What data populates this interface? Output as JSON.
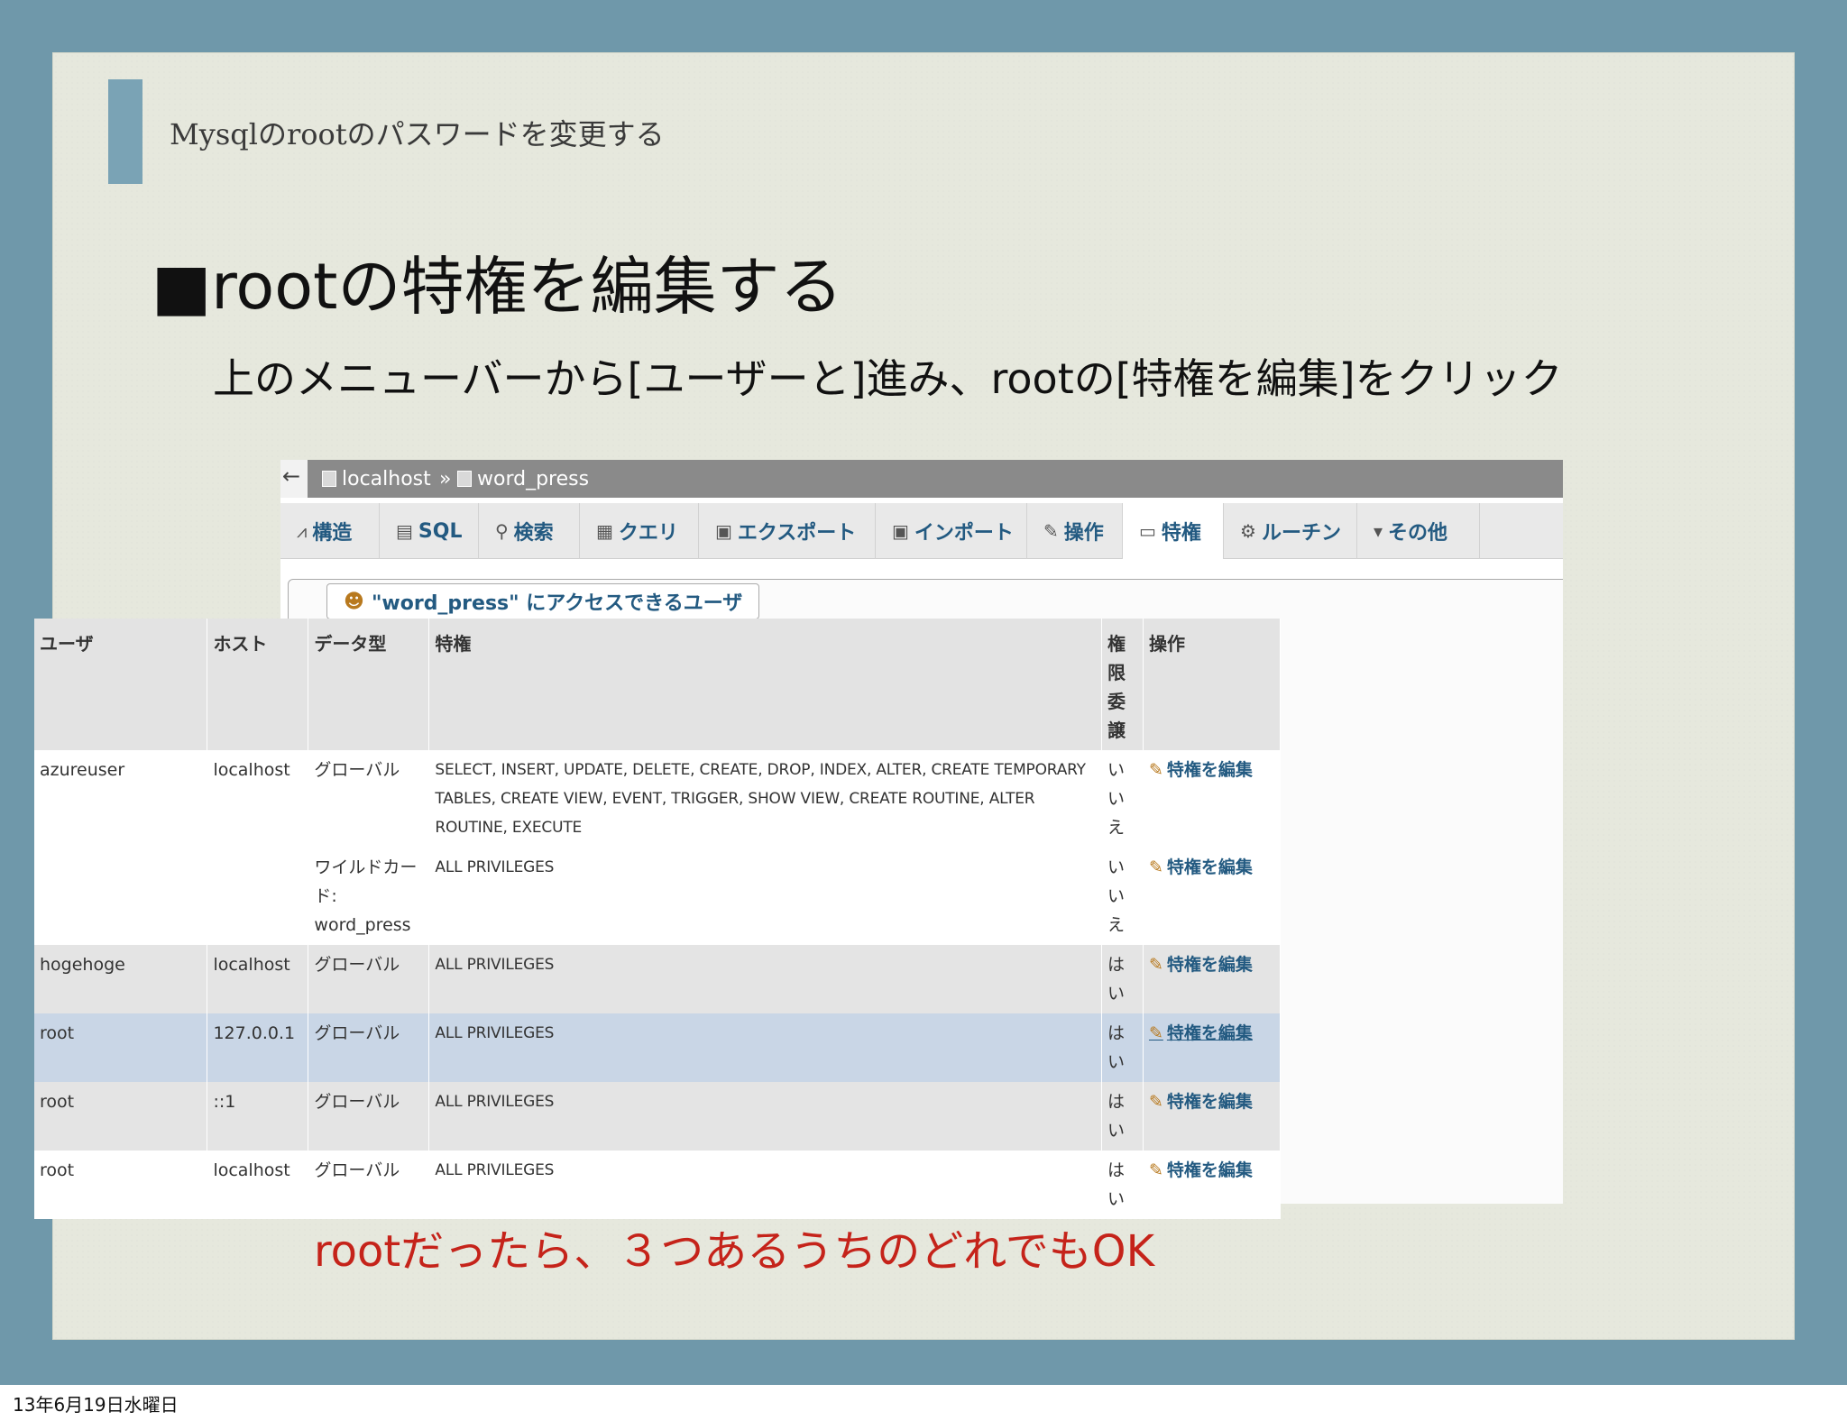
{
  "slide": {
    "header_title": "Mysqlのrootのパスワードを変更する",
    "heading": "■rootの特権を編集する",
    "instruction": "上のメニューバーから[ユーザーと]進み、rootの[特権を編集]をクリック",
    "note": "rootだったら、３つあるうちのどれでもOK",
    "date": "13年6月19日水曜日",
    "colors": {
      "frame": "#6f98aa",
      "paper": "#e6e8dd",
      "accent_bar": "#7aa3b5",
      "note": "#c5231a"
    }
  },
  "screenshot": {
    "breadcrumb": {
      "back": "←",
      "server": "localhost",
      "separator": "»",
      "database": "word_press"
    },
    "tabs": [
      {
        "label": "構造",
        "icon": "structure-icon"
      },
      {
        "label": "SQL",
        "icon": "sql-icon"
      },
      {
        "label": "検索",
        "icon": "search-icon"
      },
      {
        "label": "クエリ",
        "icon": "query-icon"
      },
      {
        "label": "エクスポート",
        "icon": "export-icon"
      },
      {
        "label": "インポート",
        "icon": "import-icon"
      },
      {
        "label": "操作",
        "icon": "wrench-icon"
      },
      {
        "label": "特権",
        "icon": "privileges-icon",
        "active": true
      },
      {
        "label": "ルーチン",
        "icon": "routines-icon"
      },
      {
        "label": "その他",
        "icon": "chevron-down-icon"
      }
    ],
    "legend": "\"word_press\" にアクセスできるユーザ",
    "columns": {
      "user": "ユーザ",
      "host": "ホスト",
      "type": "データ型",
      "privileges": "特権",
      "grant": "権限委譲",
      "action": "操作"
    },
    "edit_label": "特権を編集",
    "rows": [
      {
        "user": "azureuser",
        "host": "localhost",
        "type": "グローバル",
        "privileges": "SELECT, INSERT, UPDATE, DELETE, CREATE, DROP, INDEX, ALTER, CREATE TEMPORARY TABLES, CREATE VIEW, EVENT, TRIGGER, SHOW VIEW, CREATE ROUTINE, ALTER ROUTINE, EXECUTE",
        "grant": "いいえ"
      },
      {
        "user": "",
        "host": "",
        "type": "ワイルドカード: word_press",
        "privileges": "ALL PRIVILEGES",
        "grant": "いいえ"
      },
      {
        "user": "hogehoge",
        "host": "localhost",
        "type": "グローバル",
        "privileges": "ALL PRIVILEGES",
        "grant": "はい"
      },
      {
        "user": "root",
        "host": "127.0.0.1",
        "type": "グローバル",
        "privileges": "ALL PRIVILEGES",
        "grant": "はい"
      },
      {
        "user": "root",
        "host": "::1",
        "type": "グローバル",
        "privileges": "ALL PRIVILEGES",
        "grant": "はい"
      },
      {
        "user": "root",
        "host": "localhost",
        "type": "グローバル",
        "privileges": "ALL PRIVILEGES",
        "grant": "はい"
      }
    ]
  }
}
